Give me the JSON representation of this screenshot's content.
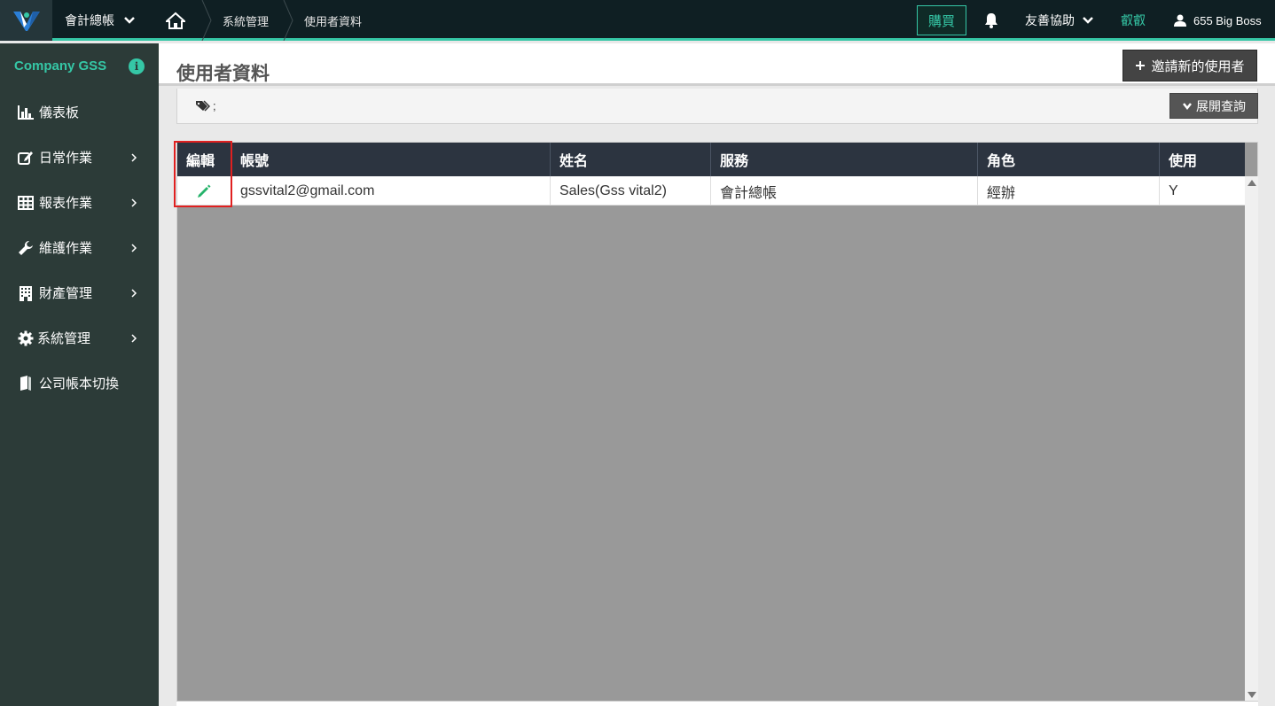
{
  "topbar": {
    "app_menu": "會計總帳",
    "breadcrumb": [
      "系統管理",
      "使用者資料"
    ],
    "buy_label": "購買",
    "help_label": "友善協助",
    "language_label": "叡叡",
    "user_label": "655 Big Boss",
    "accent_color": "#35c7a6"
  },
  "sidebar": {
    "company": "Company GSS",
    "items": [
      {
        "label": "儀表板",
        "icon": "bar-chart-icon",
        "has_submenu": false
      },
      {
        "label": "日常作業",
        "icon": "edit-icon",
        "has_submenu": true
      },
      {
        "label": "報表作業",
        "icon": "table-icon",
        "has_submenu": true
      },
      {
        "label": "維護作業",
        "icon": "wrench-icon",
        "has_submenu": true
      },
      {
        "label": "財產管理",
        "icon": "building-icon",
        "has_submenu": true
      },
      {
        "label": "系統管理",
        "icon": "gear-icon",
        "has_submenu": true
      },
      {
        "label": "公司帳本切換",
        "icon": "book-icon",
        "has_submenu": false
      }
    ]
  },
  "page": {
    "title": "使用者資料",
    "invite_button": "邀請新的使用者",
    "query_tags": ";",
    "expand_query_button": "展開查詢"
  },
  "table": {
    "columns": [
      "編輯",
      "帳號",
      "姓名",
      "服務",
      "角色",
      "使用"
    ],
    "rows": [
      {
        "account": "gssvital2@gmail.com",
        "name": "Sales(Gss vital2)",
        "service": "會計總帳",
        "role": "經辦",
        "active": "Y"
      }
    ]
  }
}
